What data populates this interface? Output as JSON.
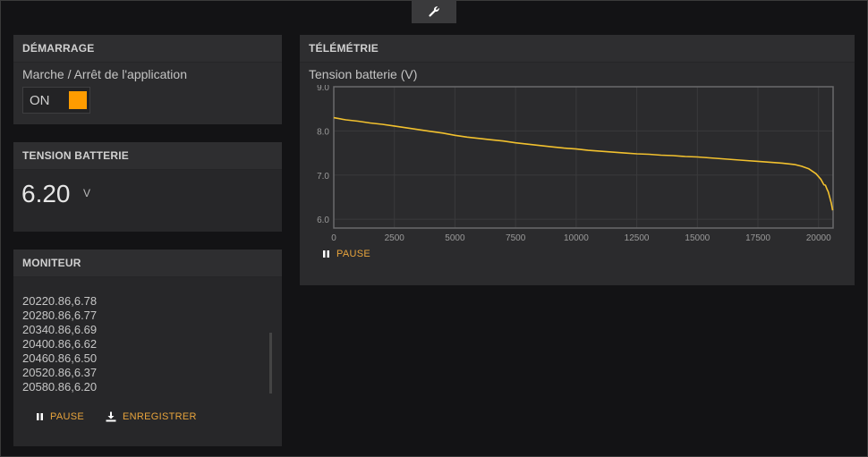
{
  "toolbar": {
    "icon": "wrench-icon"
  },
  "demarrage": {
    "title": "DÉMARRAGE",
    "label": "Marche / Arrêt de l'application",
    "switch_label": "ON",
    "switch_on": true
  },
  "tension": {
    "title": "TENSION BATTERIE",
    "value": "6.20",
    "unit": "V"
  },
  "moniteur": {
    "title": "MONITEUR",
    "lines": [
      "20220.86,6.78",
      "20280.86,6.77",
      "20340.86,6.69",
      "20400.86,6.62",
      "20460.86,6.50",
      "20520.86,6.37",
      "20580.86,6.20"
    ],
    "pause_label": "PAUSE",
    "save_label": "ENREGISTRER"
  },
  "telemetrie": {
    "title": "TÉLÉMÉTRIE",
    "pause_label": "PAUSE"
  },
  "colors": {
    "accent": "#ff9c00",
    "action_text": "#e8a43c",
    "line": "#f2c12e",
    "card": "#2b2b2d",
    "background": "#131315"
  },
  "chart_data": {
    "type": "line",
    "title": "Tension batterie (V)",
    "xlabel": "",
    "ylabel": "",
    "xlim": [
      0,
      20600
    ],
    "ylim": [
      5.8,
      9.0
    ],
    "xticks": [
      0,
      2500,
      5000,
      7500,
      10000,
      12500,
      15000,
      17500,
      20000
    ],
    "yticks": [
      6.0,
      7.0,
      8.0,
      9.0
    ],
    "grid": true,
    "series": [
      {
        "x": [
          0,
          500,
          1000,
          1500,
          2000,
          2500,
          3000,
          3500,
          4000,
          4500,
          5000,
          5500,
          6000,
          6500,
          7000,
          7500,
          8000,
          8500,
          9000,
          9500,
          10000,
          10500,
          11000,
          11500,
          12000,
          12500,
          13000,
          13500,
          14000,
          14500,
          15000,
          15500,
          16000,
          16500,
          17000,
          17500,
          18000,
          18500,
          19000,
          19300,
          19600,
          19900,
          20100,
          20220.86,
          20280.86,
          20340.86,
          20400.86,
          20460.86,
          20520.86,
          20580.86
        ],
        "y": [
          8.3,
          8.25,
          8.22,
          8.18,
          8.15,
          8.11,
          8.07,
          8.03,
          7.99,
          7.95,
          7.9,
          7.86,
          7.83,
          7.8,
          7.77,
          7.73,
          7.7,
          7.67,
          7.64,
          7.61,
          7.59,
          7.56,
          7.54,
          7.52,
          7.5,
          7.48,
          7.47,
          7.45,
          7.44,
          7.42,
          7.41,
          7.39,
          7.37,
          7.35,
          7.33,
          7.31,
          7.29,
          7.27,
          7.24,
          7.2,
          7.14,
          7.03,
          6.9,
          6.78,
          6.77,
          6.69,
          6.62,
          6.5,
          6.37,
          6.2
        ]
      }
    ]
  }
}
